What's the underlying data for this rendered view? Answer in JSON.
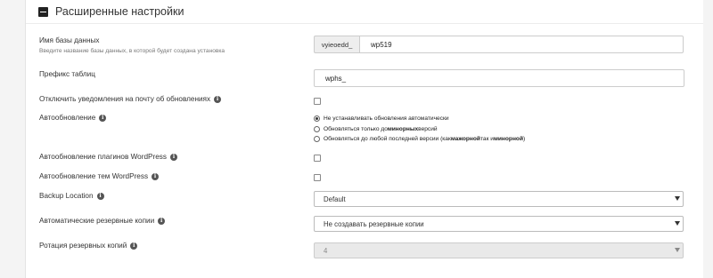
{
  "section": {
    "title": "Расширенные настройки"
  },
  "db": {
    "label": "Имя базы данных",
    "hint": "Введите название базы данных, в которой будет создана установка",
    "prefix": "vyieoedd_",
    "value": "wp519"
  },
  "table_prefix": {
    "label": "Префикс таблиц",
    "value": "wphs_"
  },
  "disable_update_email": {
    "label": "Отключить уведомления на почту об обновлениях",
    "checked": false
  },
  "auto_update": {
    "label": "Автообновление",
    "options": [
      {
        "parts": [
          "Не устанавливать обновления автоматически"
        ],
        "checked": true
      },
      {
        "parts": [
          "Обновляться только до ",
          "минорных",
          " версий"
        ],
        "checked": false
      },
      {
        "parts": [
          "Обновляться до любой последней версии (как ",
          "мажорной",
          " так и ",
          "минорной",
          ")"
        ],
        "checked": false
      }
    ]
  },
  "auto_update_plugins": {
    "label": "Автообновление плагинов WordPress",
    "checked": false
  },
  "auto_update_themes": {
    "label": "Автообновление тем WordPress",
    "checked": false
  },
  "backup_location": {
    "label": "Backup Location",
    "selected": "Default"
  },
  "auto_backups": {
    "label": "Автоматические резервные копии",
    "selected": "Не создавать резервные копии"
  },
  "backup_rotation": {
    "label": "Ротация резервных копий",
    "selected": "4",
    "disabled": true
  },
  "icons": {
    "collapse": "minus-square-icon",
    "info": "info-circle-icon",
    "caret": "caret-down-icon"
  }
}
